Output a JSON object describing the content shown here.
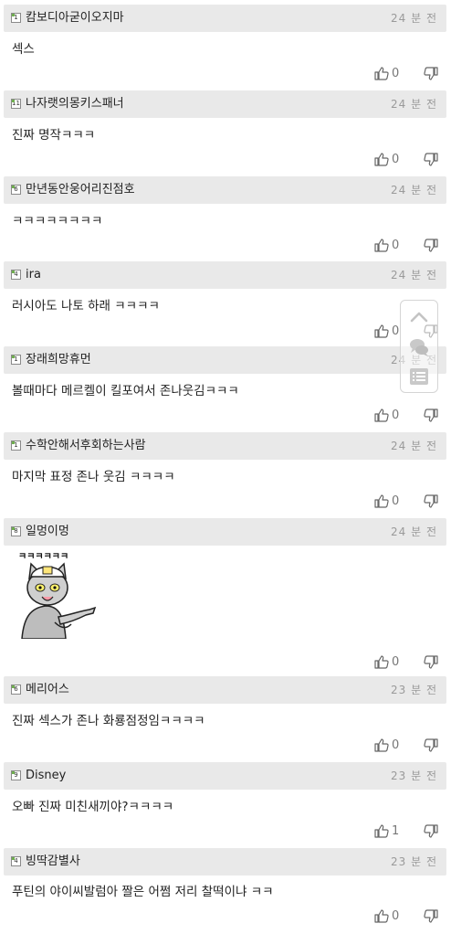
{
  "comments": [
    {
      "nick": "캄보디아굳이오지마",
      "level": "1",
      "time": "24 분 전",
      "text": "섹스",
      "likes": "0"
    },
    {
      "nick": "나자랫의몽키스패너",
      "level": "11",
      "time": "24 분 전",
      "text": "진짜 명작ㅋㅋㅋ",
      "likes": "0"
    },
    {
      "nick": "만년동안웅어리진점호",
      "level": "6",
      "time": "24 분 전",
      "text": "ㅋㅋㅋㅋㅋㅋㅋㅋ",
      "likes": "0"
    },
    {
      "nick": "ira",
      "level": "4",
      "time": "24 분 전",
      "text": "러시아도 나토 하래 ㅋㅋㅋㅋ",
      "likes": "0"
    },
    {
      "nick": "장래희망휴먼",
      "level": "1",
      "time": "24 분 전",
      "text": "볼때마다 메르켈이 킬포여서 존나웃김ㅋㅋㅋ",
      "likes": "0"
    },
    {
      "nick": "수학안해서후회하는사람",
      "level": "1",
      "time": "24 분 전",
      "text": "마지막 표정 존나 웃김 ㅋㅋㅋㅋ",
      "likes": "0"
    },
    {
      "nick": "일멍이멍",
      "level": "8",
      "time": "24 분 전",
      "text": "",
      "sticker_text": "ㅋㅋㅋㅋㅋㅋ",
      "likes": "0"
    },
    {
      "nick": "메리어스",
      "level": "6",
      "time": "23 분 전",
      "text": "진짜 섹스가 존나 화룡점정임ㅋㅋㅋㅋ",
      "likes": "0"
    },
    {
      "nick": "Disney",
      "level": "9",
      "time": "23 분 전",
      "text": "오빠 진짜 미친새끼야?ㅋㅋㅋㅋ",
      "likes": "1"
    },
    {
      "nick": "빙딱감별사",
      "level": "4",
      "time": "23 분 전",
      "text": "푸틴의 야이씨발럼아 짤은 어쩜 저리 찰떡이냐 ㅋㅋ",
      "likes": "0"
    }
  ],
  "icons": {
    "like": "thumbs-up-icon",
    "dislike": "thumbs-down-icon",
    "scroll_top": "chevron-up-icon",
    "comments": "chat-bubbles-icon",
    "list": "list-icon"
  },
  "colors": {
    "header_bg": "#e9e9e9",
    "time_text": "#9a9a9a",
    "level_badge": "#6fae4f"
  }
}
